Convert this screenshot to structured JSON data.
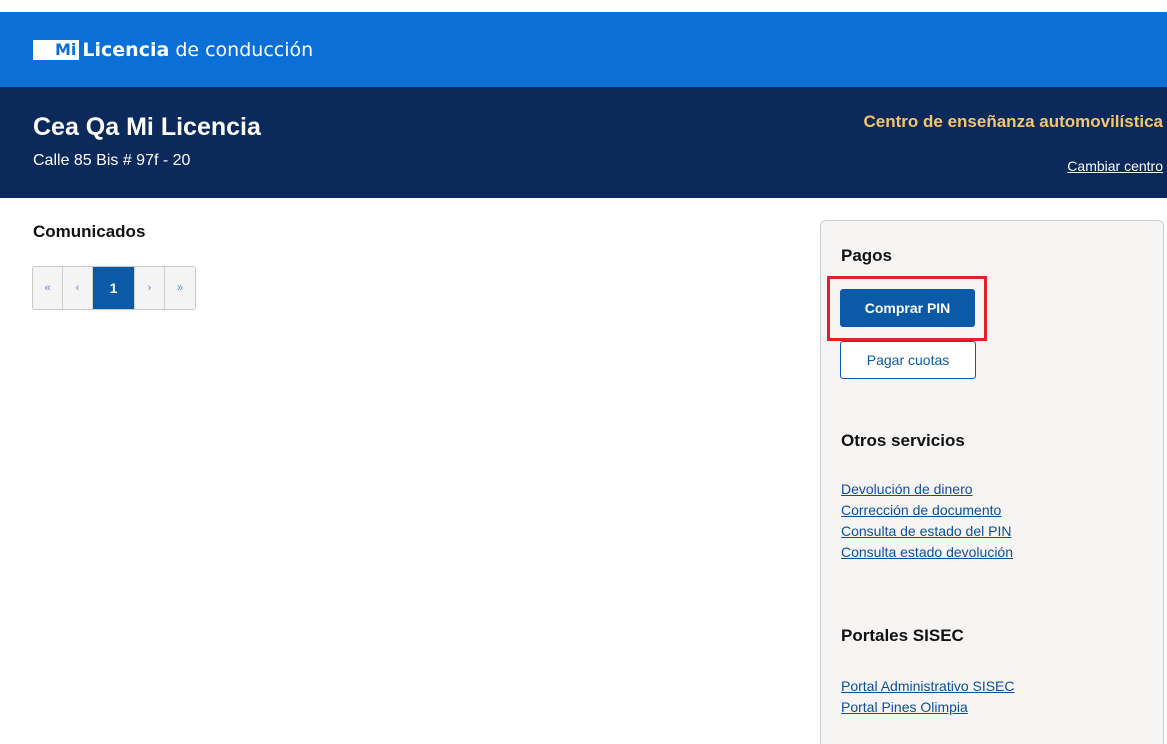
{
  "brand": {
    "mi": "Mi",
    "licencia": "Licencia",
    "rest": "de conducción"
  },
  "center": {
    "name": "Cea Qa Mi Licencia",
    "address": "Calle 85 Bis # 97f - 20",
    "type": "Centro de enseñanza automovilística",
    "change_label": "Cambiar centro"
  },
  "comunicados": {
    "title": "Comunicados",
    "pagination": {
      "first": "«",
      "prev": "‹",
      "current": "1",
      "next": "›",
      "last": "»"
    }
  },
  "panel": {
    "pagos": {
      "title": "Pagos",
      "buy_label": "Comprar PIN",
      "pay_label": "Pagar cuotas"
    },
    "otros": {
      "title": "Otros servicios",
      "links": [
        "Devolución de dinero",
        "Corrección de documento",
        "Consulta de estado del PIN",
        "Consulta estado devolución"
      ]
    },
    "portales": {
      "title": "Portales SISEC",
      "links": [
        "Portal Administrativo SISEC",
        "Portal Pines Olimpia"
      ]
    }
  },
  "colors": {
    "brand_blue": "#0a6fd6",
    "header_navy": "#0b2a5b",
    "accent_gold": "#f5c56a",
    "button_blue": "#0b5aa8",
    "highlight_red": "#e0202a"
  }
}
